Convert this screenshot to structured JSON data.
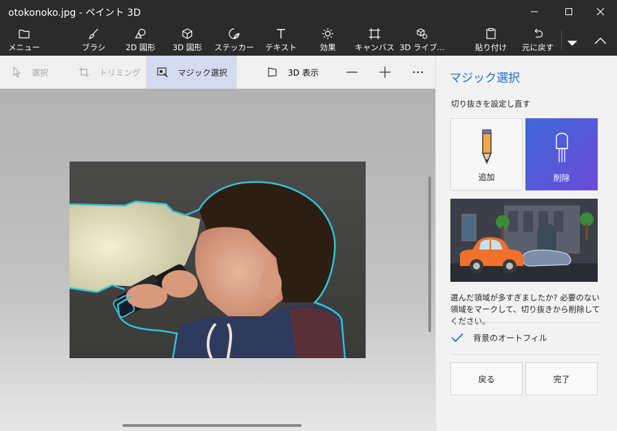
{
  "window": {
    "title": "otokonoko.jpg - ペイント 3D",
    "minimize": "minimize-icon",
    "maximize": "maximize-icon",
    "close": "close-icon"
  },
  "ribbon": {
    "items": [
      {
        "label": "メニュー",
        "icon": "folder-icon"
      },
      {
        "label": "ブラシ",
        "icon": "brush-icon"
      },
      {
        "label": "2D 図形",
        "icon": "shapes-2d-icon"
      },
      {
        "label": "3D 図形",
        "icon": "cube-icon"
      },
      {
        "label": "ステッカー",
        "icon": "sticker-icon"
      },
      {
        "label": "テキスト",
        "icon": "text-icon"
      },
      {
        "label": "効果",
        "icon": "effects-icon"
      },
      {
        "label": "キャンバス",
        "icon": "canvas-icon"
      },
      {
        "label": "3D ライブ...",
        "icon": "library-3d-icon"
      },
      {
        "label": "貼り付け",
        "icon": "paste-icon"
      },
      {
        "label": "元に戻す",
        "icon": "undo-icon"
      }
    ]
  },
  "toolbar": {
    "select": "選択",
    "crop": "トリミング",
    "magic_select": "マジック選択",
    "view_3d": "3D 表示"
  },
  "panel": {
    "heading": "マジック選択",
    "subheading": "切り抜きを設定し直す",
    "add_label": "追加",
    "remove_label": "削除",
    "help_text": "選んだ領域が多すぎましたか? 必要のない領域をマークして、切り抜きから削除してください。",
    "autofill_label": "背景のオートフィル",
    "autofill_checked": true,
    "back_label": "戻る",
    "done_label": "完了"
  },
  "colors": {
    "accent": "#1e6ccf",
    "remove_gradient_start": "#3d6ad8",
    "remove_gradient_end": "#6c4ad8",
    "selection_outline": "#2ec4d6"
  }
}
